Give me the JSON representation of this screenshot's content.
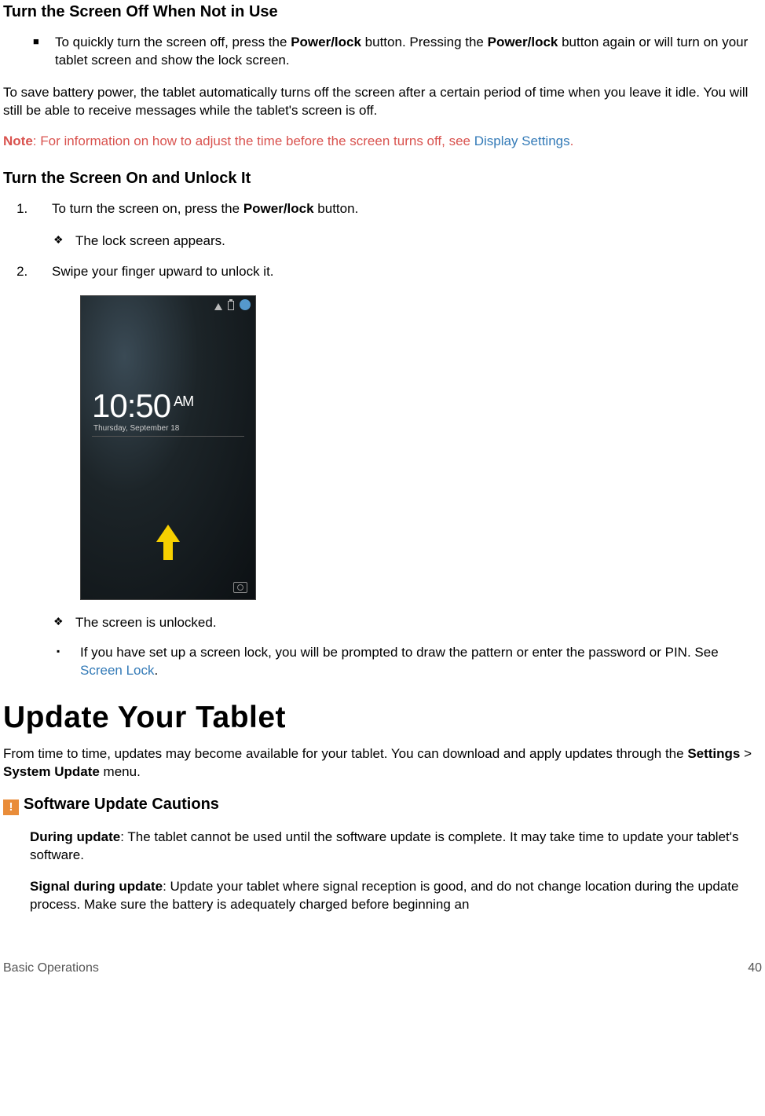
{
  "section1": {
    "heading": "Turn the Screen Off When Not in Use",
    "bullet_pre": "To quickly turn the screen off, press the ",
    "bullet_bold1": "Power/lock",
    "bullet_mid": " button. Pressing the ",
    "bullet_bold2": "Power/lock",
    "bullet_post": " button again or will turn on your tablet screen and show the lock screen.",
    "para": "To save battery power, the tablet automatically turns off the screen after a certain period of time when you leave it idle. You will still be able to receive messages while the tablet's screen is off.",
    "note_label": "Note",
    "note_text": ": For information on how to adjust the time before the screen turns off, see ",
    "note_link": "Display Settings",
    "note_after": "."
  },
  "section2": {
    "heading": "Turn the Screen On and Unlock It",
    "step1_pre": "To turn the screen on, press the ",
    "step1_bold": "Power/lock",
    "step1_post": " button.",
    "sub1": "The lock screen appears.",
    "step2": "Swipe your finger upward to unlock it.",
    "sub2": "The screen is unlocked.",
    "sub3_pre": "If you have set up a screen lock, you will be prompted to draw the pattern or enter the password or PIN. See ",
    "sub3_link": "Screen Lock",
    "sub3_post": "."
  },
  "lockscreen": {
    "time": "10:50",
    "ampm": "AM",
    "date": "Thursday, September 18"
  },
  "update": {
    "heading": "Update Your Tablet",
    "intro_pre": "From time to time, updates may become available for your tablet. You can download and apply updates through the ",
    "intro_b1": "Settings",
    "intro_mid": " > ",
    "intro_b2": "System Update",
    "intro_post": " menu.",
    "caution_heading": "Software Update Cautions",
    "c1_label": "During update",
    "c1_text": ": The tablet cannot be used until the software update is complete. It may take time to update your tablet's software.",
    "c2_label": "Signal during update",
    "c2_text": ": Update your tablet where signal reception is good, and do not change location during the update process. Make sure the battery is adequately charged before beginning an"
  },
  "footer": {
    "section": "Basic Operations",
    "page": "40"
  }
}
